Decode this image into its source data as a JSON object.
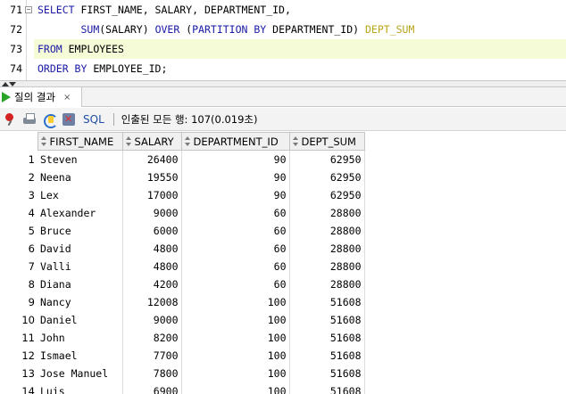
{
  "editor": {
    "line_numbers": [
      "71",
      "72",
      "73",
      "74"
    ],
    "lines": [
      {
        "parts": [
          {
            "t": "SELECT",
            "c": "kw"
          },
          {
            "t": " FIRST_NAME, SALARY, DEPARTMENT_ID,",
            "c": ""
          }
        ]
      },
      {
        "parts": [
          {
            "t": "       ",
            "c": ""
          },
          {
            "t": "SUM",
            "c": "fn"
          },
          {
            "t": "(SALARY) ",
            "c": ""
          },
          {
            "t": "OVER",
            "c": "kw"
          },
          {
            "t": " (",
            "c": ""
          },
          {
            "t": "PARTITION BY",
            "c": "kw"
          },
          {
            "t": " DEPARTMENT_ID) ",
            "c": ""
          },
          {
            "t": "DEPT_SUM",
            "c": "al"
          }
        ]
      },
      {
        "parts": [
          {
            "t": "FROM",
            "c": "kw"
          },
          {
            "t": " EMPLOYEES",
            "c": ""
          }
        ]
      },
      {
        "parts": [
          {
            "t": "ORDER BY",
            "c": "kw"
          },
          {
            "t": " EMPLOYEE_ID;",
            "c": ""
          }
        ]
      }
    ]
  },
  "result_tab": {
    "label": "질의 결과",
    "close": "×"
  },
  "toolbar": {
    "sql_label": "SQL",
    "status": "인출된 모든 행: 107(0.019초)"
  },
  "grid": {
    "columns": [
      "FIRST_NAME",
      "SALARY",
      "DEPARTMENT_ID",
      "DEPT_SUM"
    ],
    "rows": [
      [
        "1",
        "Steven",
        "26400",
        "90",
        "62950"
      ],
      [
        "2",
        "Neena",
        "19550",
        "90",
        "62950"
      ],
      [
        "3",
        "Lex",
        "17000",
        "90",
        "62950"
      ],
      [
        "4",
        "Alexander",
        "9000",
        "60",
        "28800"
      ],
      [
        "5",
        "Bruce",
        "6000",
        "60",
        "28800"
      ],
      [
        "6",
        "David",
        "4800",
        "60",
        "28800"
      ],
      [
        "7",
        "Valli",
        "4800",
        "60",
        "28800"
      ],
      [
        "8",
        "Diana",
        "4200",
        "60",
        "28800"
      ],
      [
        "9",
        "Nancy",
        "12008",
        "100",
        "51608"
      ],
      [
        "10",
        "Daniel",
        "9000",
        "100",
        "51608"
      ],
      [
        "11",
        "John",
        "8200",
        "100",
        "51608"
      ],
      [
        "12",
        "Ismael",
        "7700",
        "100",
        "51608"
      ],
      [
        "13",
        "Jose Manuel",
        "7800",
        "100",
        "51608"
      ],
      [
        "14",
        "Luis",
        "6900",
        "100",
        "51608"
      ]
    ]
  }
}
